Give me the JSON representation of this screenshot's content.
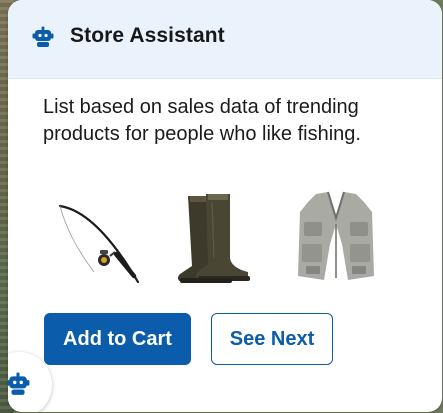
{
  "header": {
    "icon": "robot-icon",
    "title": "Store Assistant"
  },
  "message": {
    "text": "List based on sales data of trending products for people who like fishing."
  },
  "products": [
    {
      "icon": "fishing-rod-icon"
    },
    {
      "icon": "rain-boots-icon"
    },
    {
      "icon": "fishing-vest-icon"
    }
  ],
  "actions": {
    "primary_label": "Add to Cart",
    "secondary_label": "See Next"
  },
  "launcher": {
    "icon": "robot-icon"
  },
  "colors": {
    "brand_blue": "#0b5cab",
    "header_bg": "#eaf2fb",
    "text": "#181818"
  }
}
